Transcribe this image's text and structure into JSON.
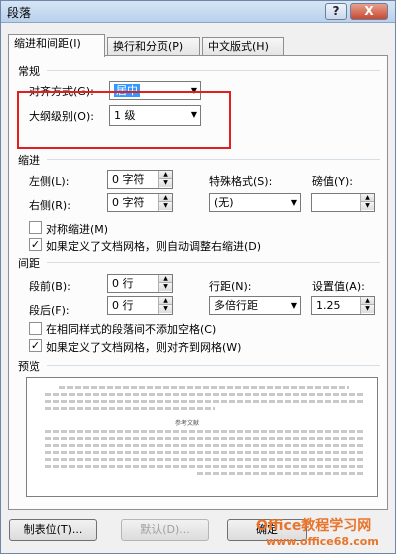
{
  "window": {
    "title": "段落",
    "help": "?",
    "close": "X"
  },
  "tabs": [
    {
      "label": "缩进和间距(I)"
    },
    {
      "label": "换行和分页(P)"
    },
    {
      "label": "中文版式(H)"
    }
  ],
  "general": {
    "heading": "常规",
    "alignment_label": "对齐方式(G):",
    "alignment_value": "居中",
    "outline_label": "大纲级别(O):",
    "outline_value": "1 级"
  },
  "indent": {
    "heading": "缩进",
    "left_label": "左侧(L):",
    "left_value": "0 字符",
    "right_label": "右侧(R):",
    "right_value": "0 字符",
    "special_label": "特殊格式(S):",
    "special_value": "(无)",
    "by_label": "磅值(Y):",
    "by_value": "",
    "mirror_label": "对称缩进(M)",
    "mirror_checked": false,
    "auto_right_label": "如果定义了文档网格，则自动调整右缩进(D)",
    "auto_right_checked": true
  },
  "spacing": {
    "heading": "间距",
    "before_label": "段前(B):",
    "before_value": "0 行",
    "after_label": "段后(F):",
    "after_value": "0 行",
    "line_label": "行距(N):",
    "line_value": "多倍行距",
    "at_label": "设置值(A):",
    "at_value": "1.25",
    "no_space_label": "在相同样式的段落间不添加空格(C)",
    "no_space_checked": false,
    "snap_grid_label": "如果定义了文档网格，则对齐到网格(W)",
    "snap_grid_checked": true
  },
  "preview": {
    "heading": "预览",
    "sample_text": "参考文献"
  },
  "buttons": {
    "tabs": "制表位(T)...",
    "default": "默认(D)...",
    "ok": "确定"
  },
  "watermark": {
    "line1": "Office教程学习网",
    "line2": "www.office68.com"
  },
  "colors": {
    "highlight": "#3399ff",
    "annotation": "#e0201f",
    "watermark": "#e8742b"
  }
}
